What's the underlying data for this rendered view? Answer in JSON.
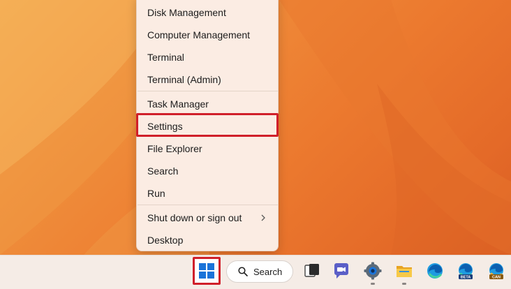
{
  "context_menu": {
    "items": [
      {
        "label": "Disk Management"
      },
      {
        "label": "Computer Management"
      },
      {
        "label": "Terminal"
      },
      {
        "label": "Terminal (Admin)"
      },
      {
        "label": "Task Manager"
      },
      {
        "label": "Settings"
      },
      {
        "label": "File Explorer"
      },
      {
        "label": "Search"
      },
      {
        "label": "Run"
      },
      {
        "label": "Shut down or sign out"
      },
      {
        "label": "Desktop"
      }
    ],
    "highlighted_item": "Settings"
  },
  "taskbar": {
    "search_label": "Search",
    "icons": [
      {
        "name": "start-icon"
      },
      {
        "name": "search-icon"
      },
      {
        "name": "task-view-icon"
      },
      {
        "name": "teams-chat-icon"
      },
      {
        "name": "settings-gear-icon"
      },
      {
        "name": "file-explorer-icon"
      },
      {
        "name": "edge-icon"
      },
      {
        "name": "edge-beta-icon",
        "badge": "BETA"
      },
      {
        "name": "edge-canary-icon",
        "badge": "CAN"
      }
    ]
  },
  "colors": {
    "highlight_border": "#d01f2a",
    "menu_background": "#fbece3",
    "taskbar_background": "#f5ece6",
    "windows_blue": "#1a73d9"
  }
}
